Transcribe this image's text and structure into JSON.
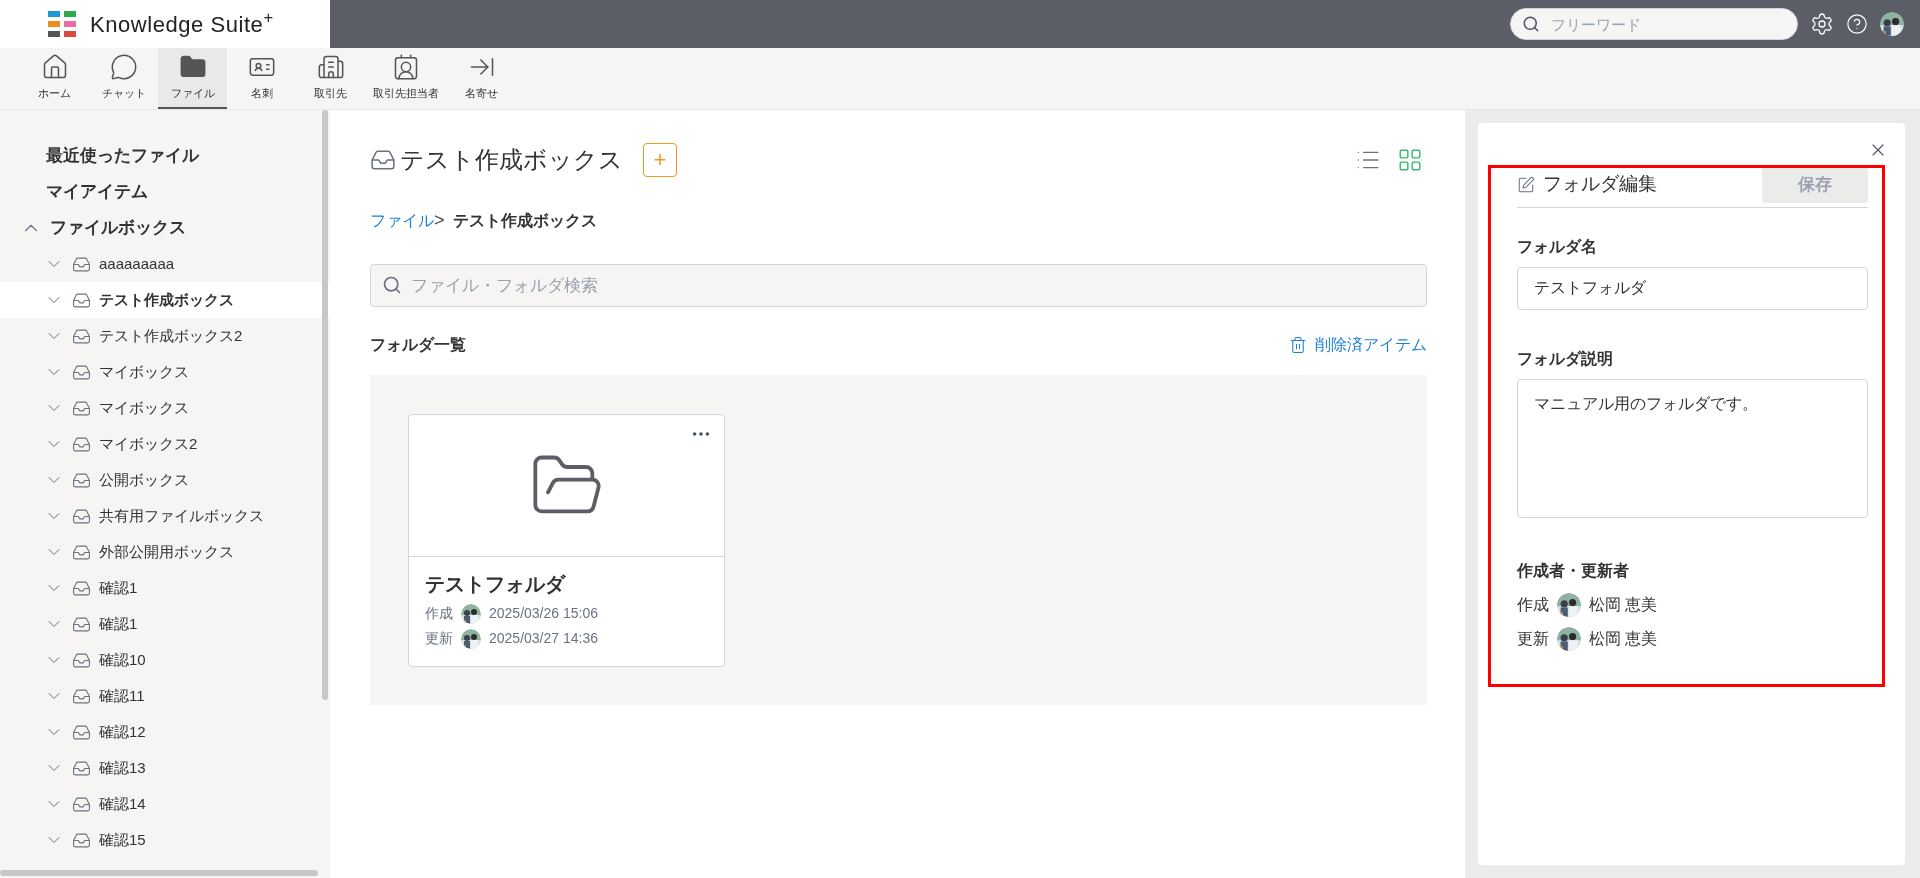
{
  "header": {
    "logo": "Knowledge Suite$^{+}$",
    "search": {
      "placeholder": "フリーワード"
    }
  },
  "nav": [
    {
      "label": "ホーム",
      "selected": false
    },
    {
      "label": "チャット",
      "selected": false
    },
    {
      "label": "ファイル",
      "selected": true
    },
    {
      "label": "名刺",
      "selected": false
    },
    {
      "label": "取引先",
      "selected": false
    },
    {
      "label": "取引先担当者",
      "selected": false
    },
    {
      "label": "名寄せ",
      "selected": false
    }
  ],
  "sidebar": {
    "links": [
      {
        "label": "最近使ったファイル"
      },
      {
        "label": "マイアイテム"
      }
    ],
    "tree": [
      {
        "label": "ファイルボックス",
        "expanded": true,
        "children": [
          {
            "label": "aaaaaaaaa",
            "expanded": false,
            "selected": false
          },
          {
            "label": "テスト作成ボックス",
            "expanded": false,
            "selected": true
          },
          {
            "label": "テスト作成ボックス2",
            "expanded": false,
            "selected": false
          },
          {
            "label": "マイボックス",
            "expanded": false,
            "selected": false
          },
          {
            "label": "マイボックス",
            "expanded": false,
            "selected": false
          },
          {
            "label": "マイボックス2",
            "expanded": false,
            "selected": false
          },
          {
            "label": "公開ボックス",
            "expanded": false,
            "selected": false
          },
          {
            "label": "共有用ファイルボックス",
            "expanded": false,
            "selected": false
          },
          {
            "label": "外部公開用ボックス",
            "expanded": false,
            "selected": false
          },
          {
            "label": "確認1",
            "expanded": false,
            "selected": false
          },
          {
            "label": "確認1",
            "expanded": false,
            "selected": false
          },
          {
            "label": "確認10",
            "expanded": false,
            "selected": false
          },
          {
            "label": "確認11",
            "expanded": false,
            "selected": false
          },
          {
            "label": "確認12",
            "expanded": false,
            "selected": false
          },
          {
            "label": "確認13",
            "expanded": false,
            "selected": false
          },
          {
            "label": "確認14",
            "expanded": false,
            "selected": false
          },
          {
            "label": "確認15",
            "expanded": false,
            "selected": false
          }
        ]
      }
    ]
  },
  "main": {
    "title": "テスト作成ボックス",
    "add_button": "+",
    "view_modes": [
      {
        "kind": "list",
        "selected": false
      },
      {
        "kind": "grid",
        "selected": true
      }
    ],
    "breadcrumb": {
      "items": [
        {
          "label": "ファイル",
          "link": true
        },
        {
          "label": "テスト作成ボックス",
          "link": false
        }
      ],
      "separator": ">"
    },
    "search": {
      "placeholder": "ファイル・フォルダ検索"
    },
    "section_title": "フォルダ一覧",
    "deleted_link": "削除済アイテム",
    "folders": [
      {
        "name": "テストフォルダ",
        "created_label": "作成",
        "created": "2025/03/26 15:06",
        "updated_label": "更新",
        "updated": "2025/03/27 14:36"
      }
    ]
  },
  "panel": {
    "title": "フォルダ編集",
    "save_button": {
      "label": "保存",
      "disabled": true
    },
    "name_label": "フォルダ名",
    "name_value": "テストフォルダ",
    "description_label": "フォルダ説明",
    "description_value": "マニュアル用のフォルダです。",
    "people_label": "作成者・更新者",
    "people": [
      {
        "label": "作成",
        "name": "松岡 恵美"
      },
      {
        "label": "更新",
        "name": "松岡 恵美"
      }
    ]
  }
}
